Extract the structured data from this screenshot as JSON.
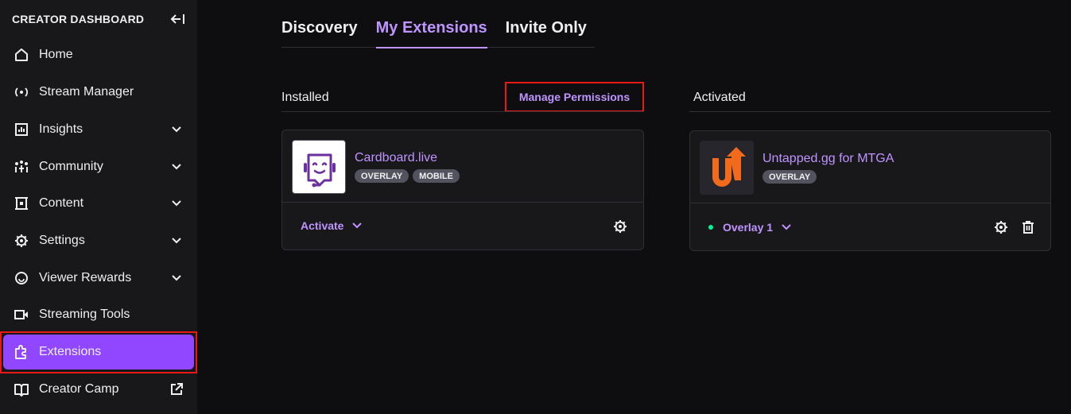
{
  "sidebar": {
    "title": "CREATOR DASHBOARD",
    "items": [
      {
        "label": "Home"
      },
      {
        "label": "Stream Manager"
      },
      {
        "label": "Insights"
      },
      {
        "label": "Community"
      },
      {
        "label": "Content"
      },
      {
        "label": "Settings"
      },
      {
        "label": "Viewer Rewards"
      },
      {
        "label": "Streaming Tools"
      },
      {
        "label": "Extensions"
      },
      {
        "label": "Creator Camp"
      }
    ]
  },
  "tabs": [
    {
      "label": "Discovery"
    },
    {
      "label": "My Extensions"
    },
    {
      "label": "Invite Only"
    }
  ],
  "installed": {
    "label": "Installed",
    "manage_permissions": "Manage Permissions",
    "card": {
      "name": "Cardboard.live",
      "badges": [
        "OVERLAY",
        "MOBILE"
      ],
      "action": "Activate"
    }
  },
  "activated": {
    "label": "Activated",
    "card": {
      "name": "Untapped.gg for MTGA",
      "badges": [
        "OVERLAY"
      ],
      "slot": "Overlay 1"
    }
  },
  "colors": {
    "accent": "#9147ff",
    "accent_text": "#bf94ff",
    "highlight": "#e91916",
    "active_dot": "#00f593",
    "untapped_orange": "#f26b1d"
  }
}
